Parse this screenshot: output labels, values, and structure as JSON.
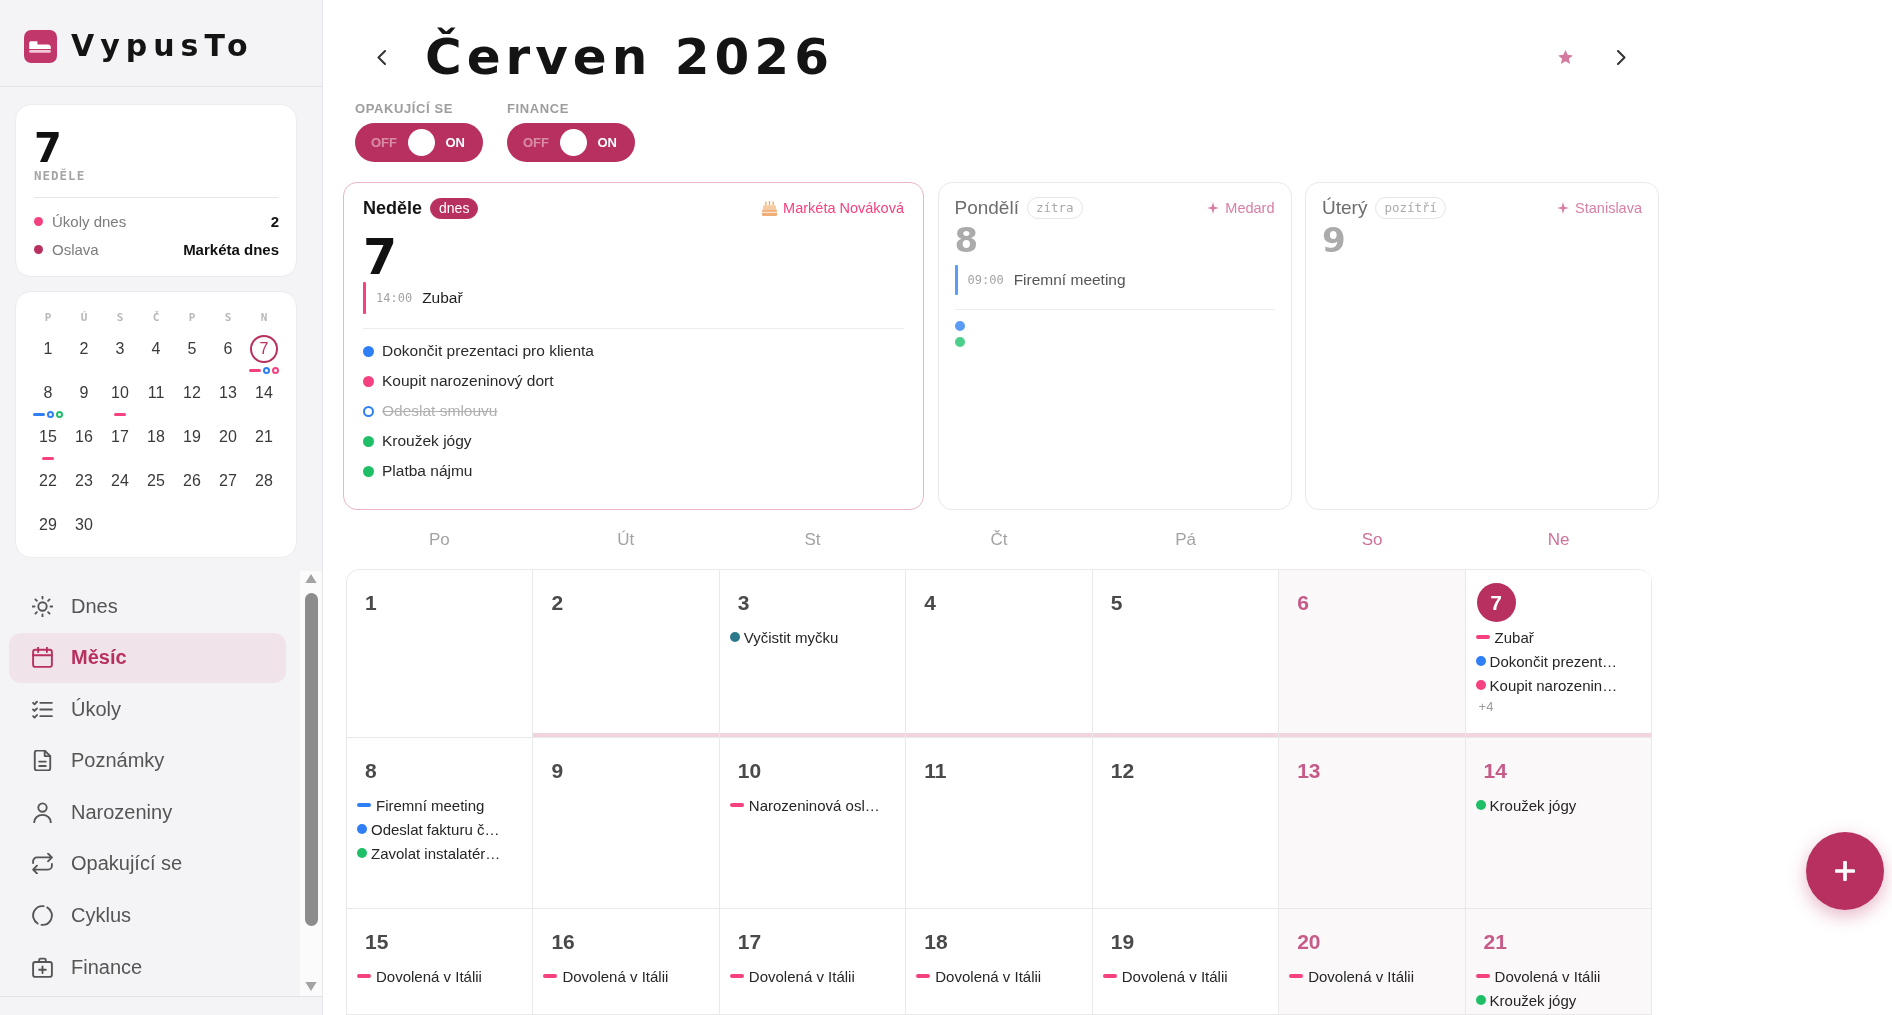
{
  "app": {
    "name": "VypusTo"
  },
  "today_summary": {
    "day": "7",
    "weekday": "NEDĚLE",
    "stats": [
      {
        "label": "Úkoly dnes",
        "value": "2",
        "color": "#f5417f"
      },
      {
        "label": "Oslava",
        "value": "Markéta dnes",
        "color": "#b8305f"
      }
    ]
  },
  "mini_calendar": {
    "weekdays": [
      "P",
      "Ú",
      "S",
      "Č",
      "P",
      "S",
      "N"
    ],
    "weeks": [
      [
        {
          "day": "1",
          "today": false
        },
        {
          "day": "2",
          "today": false
        },
        {
          "day": "3",
          "today": false
        },
        {
          "day": "4",
          "today": false
        },
        {
          "day": "5",
          "today": false
        },
        {
          "day": "6",
          "today": false
        },
        {
          "day": "7",
          "today": true,
          "marks": [
            {
              "kind": "bar",
              "color": "#f5417f"
            },
            {
              "kind": "ring",
              "color": "#2f7ff6"
            },
            {
              "kind": "ring",
              "color": "#f5417f"
            }
          ]
        }
      ],
      [
        {
          "day": "8",
          "today": false,
          "marks": [
            {
              "kind": "bar",
              "color": "#2f7ff6"
            },
            {
              "kind": "ring",
              "color": "#2f7ff6"
            },
            {
              "kind": "ring",
              "color": "#1fbf68"
            }
          ]
        },
        {
          "day": "9",
          "today": false
        },
        {
          "day": "10",
          "today": false,
          "marks": [
            {
              "kind": "bar",
              "color": "#f5417f"
            }
          ]
        },
        {
          "day": "11",
          "today": false
        },
        {
          "day": "12",
          "today": false
        },
        {
          "day": "13",
          "today": false
        },
        {
          "day": "14",
          "today": false
        }
      ],
      [
        {
          "day": "15",
          "today": false,
          "marks": [
            {
              "kind": "bar",
              "color": "#f5417f"
            }
          ]
        },
        {
          "day": "16",
          "today": false
        },
        {
          "day": "17",
          "today": false
        },
        {
          "day": "18",
          "today": false
        },
        {
          "day": "19",
          "today": false
        },
        {
          "day": "20",
          "today": false
        },
        {
          "day": "21",
          "today": false
        }
      ],
      [
        {
          "day": "22",
          "today": false
        },
        {
          "day": "23",
          "today": false
        },
        {
          "day": "24",
          "today": false
        },
        {
          "day": "25",
          "today": false
        },
        {
          "day": "26",
          "today": false
        },
        {
          "day": "27",
          "today": false
        },
        {
          "day": "28",
          "today": false
        }
      ],
      [
        {
          "day": "29",
          "today": false
        },
        {
          "day": "30",
          "today": false
        }
      ]
    ]
  },
  "nav": [
    {
      "label": "Dnes",
      "selected": false
    },
    {
      "label": "Měsíc",
      "selected": true
    },
    {
      "label": "Úkoly",
      "selected": false
    },
    {
      "label": "Poznámky",
      "selected": false
    },
    {
      "label": "Narozeniny",
      "selected": false
    },
    {
      "label": "Opakující se",
      "selected": false
    },
    {
      "label": "Cyklus",
      "selected": false
    },
    {
      "label": "Finance",
      "selected": false
    }
  ],
  "header": {
    "title": "Červen 2026"
  },
  "filters": [
    {
      "label": "OPAKUJÍCÍ SE",
      "off_label": "OFF",
      "on_label": "ON",
      "on": true
    },
    {
      "label": "FINANCE",
      "off_label": "OFF",
      "on_label": "ON",
      "on": true
    }
  ],
  "day_cards": [
    {
      "weekday": "Neděle",
      "badge": "dnes",
      "today": true,
      "day": "7",
      "celebration": {
        "kind": "birthday",
        "name": "Markéta Nováková"
      },
      "events": [
        {
          "time": "14:00",
          "title": "Zubař",
          "color": "#f5417f"
        }
      ],
      "tasks": [
        {
          "title": "Dokončit prezentaci pro klienta",
          "color": "#2f7ff6",
          "done": false
        },
        {
          "title": "Koupit narozeninový dort",
          "color": "#f5417f",
          "done": false
        },
        {
          "title": "Odeslat smlouvu",
          "color": "#2f7ff6",
          "done": true
        },
        {
          "title": "Kroužek jógy",
          "color": "#1fbf68",
          "done": false
        },
        {
          "title": "Platba nájmu",
          "color": "#1fbf68",
          "done": false
        }
      ]
    },
    {
      "weekday": "Pondělí",
      "badge": "zítra",
      "today": false,
      "day": "8",
      "celebration": {
        "kind": "nameday",
        "name": "Medard"
      },
      "events": [
        {
          "time": "09:00",
          "title": "Firemní meeting",
          "color": "#5b9cf6"
        }
      ],
      "tasks": [
        {
          "color": "#5b9cf6",
          "done": false
        },
        {
          "color": "#4ccf8a",
          "done": false
        }
      ]
    },
    {
      "weekday": "Úterý",
      "badge": "pozítří",
      "today": false,
      "day": "9",
      "celebration": {
        "kind": "nameday",
        "name": "Stanislava"
      }
    }
  ],
  "month": {
    "weekdays": [
      {
        "label": "Po",
        "weekend": false
      },
      {
        "label": "Út",
        "weekend": false
      },
      {
        "label": "St",
        "weekend": false
      },
      {
        "label": "Čt",
        "weekend": false
      },
      {
        "label": "Pá",
        "weekend": false
      },
      {
        "label": "So",
        "weekend": true
      },
      {
        "label": "Ne",
        "weekend": true
      }
    ],
    "weeks": [
      [
        {
          "day": "1",
          "today": false,
          "accent_bottom": false
        },
        {
          "day": "2",
          "today": false,
          "accent_bottom": true
        },
        {
          "day": "3",
          "today": false,
          "accent_bottom": true,
          "items": [
            {
              "kind": "task",
              "title": "Vyčistit myčku",
              "color": "#2b7a8b"
            }
          ]
        },
        {
          "day": "4",
          "today": false,
          "accent_bottom": true
        },
        {
          "day": "5",
          "today": false,
          "accent_bottom": true
        },
        {
          "day": "6",
          "today": false,
          "accent_bottom": true
        },
        {
          "day": "7",
          "today": true,
          "accent_bottom": true,
          "items": [
            {
              "kind": "event",
              "title": "Zubař",
              "color": "#f5417f"
            },
            {
              "kind": "task",
              "title": "Dokončit prezent…",
              "color": "#2f7ff6"
            },
            {
              "kind": "task",
              "title": "Koupit narozenin…",
              "color": "#f5417f"
            }
          ],
          "more": "+4"
        }
      ],
      [
        {
          "day": "8",
          "today": false,
          "accent_bottom": false,
          "items": [
            {
              "kind": "event",
              "title": "Firemní meeting",
              "color": "#2f7ff6"
            },
            {
              "kind": "task",
              "title": "Odeslat fakturu č…",
              "color": "#2f7ff6"
            },
            {
              "kind": "task",
              "title": "Zavolat instalatér…",
              "color": "#1fbf68"
            }
          ]
        },
        {
          "day": "9",
          "today": false,
          "accent_bottom": false
        },
        {
          "day": "10",
          "today": false,
          "accent_bottom": false,
          "items": [
            {
              "kind": "event",
              "title": "Narozeninová osl…",
              "color": "#f5417f"
            }
          ]
        },
        {
          "day": "11",
          "today": false,
          "accent_bottom": false
        },
        {
          "day": "12",
          "today": false,
          "accent_bottom": false
        },
        {
          "day": "13",
          "today": false,
          "accent_bottom": false
        },
        {
          "day": "14",
          "today": false,
          "accent_bottom": false,
          "items": [
            {
              "kind": "task",
              "title": "Kroužek jógy",
              "color": "#1fbf68"
            }
          ]
        }
      ],
      [
        {
          "day": "15",
          "today": false,
          "accent_bottom": false,
          "items": [
            {
              "kind": "event",
              "title": "Dovolená v Itálii",
              "color": "#f5417f"
            }
          ]
        },
        {
          "day": "16",
          "today": false,
          "accent_bottom": false,
          "items": [
            {
              "kind": "event",
              "title": "Dovolená v Itálii",
              "color": "#f5417f"
            }
          ]
        },
        {
          "day": "17",
          "today": false,
          "accent_bottom": false,
          "items": [
            {
              "kind": "event",
              "title": "Dovolená v Itálii",
              "color": "#f5417f"
            }
          ]
        },
        {
          "day": "18",
          "today": false,
          "accent_bottom": false,
          "items": [
            {
              "kind": "event",
              "title": "Dovolená v Itálii",
              "color": "#f5417f"
            }
          ]
        },
        {
          "day": "19",
          "today": false,
          "accent_bottom": false,
          "items": [
            {
              "kind": "event",
              "title": "Dovolená v Itálii",
              "color": "#f5417f"
            }
          ]
        },
        {
          "day": "20",
          "today": false,
          "accent_bottom": false,
          "items": [
            {
              "kind": "event",
              "title": "Dovolená v Itálii",
              "color": "#f5417f"
            }
          ]
        },
        {
          "day": "21",
          "today": false,
          "accent_bottom": false,
          "items": [
            {
              "kind": "event",
              "title": "Dovolená v Itálii",
              "color": "#f5417f"
            },
            {
              "kind": "task",
              "title": "Kroužek jógy",
              "color": "#1fbf68"
            }
          ]
        }
      ]
    ]
  }
}
